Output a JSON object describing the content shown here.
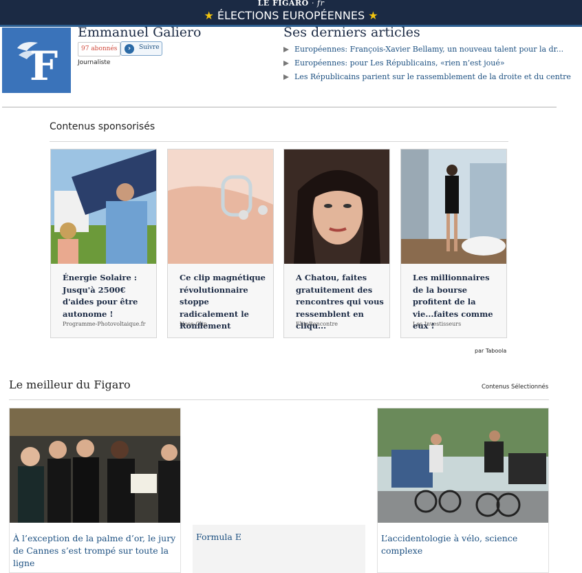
{
  "banner": {
    "brand": "LE FIGARO",
    "brand_suffix": "· fr",
    "title": "ÉLECTIONS EUROPÉENNES",
    "star": "★"
  },
  "author": {
    "logo_letter": "F",
    "name": "Emmanuel Galiero",
    "followers": "97 abonnés",
    "follow_label": "Suivre",
    "follow_icon": "›",
    "role": "Journaliste"
  },
  "latest": {
    "title": "Ses derniers articles",
    "items": [
      "Européennes: François-Xavier Bellamy, un nouveau talent pour la dr...",
      "Européennes: pour Les Républicains, «rien n’est joué»",
      "Les Républicains parient sur le rassemblement de la droite et du centre"
    ]
  },
  "sponsored": {
    "title": "Contenus sponsorisés",
    "credit": "par Taboola",
    "cards": [
      {
        "headline": "Énergie Solaire : Jusqu'à 2500€ d'aides pour être autonome !",
        "source": "Programme-Photovoltaique.fr"
      },
      {
        "headline": "Ce clip magnétique révolutionnaire stoppe radicalement le Ronflement",
        "source": "Nose-Clip"
      },
      {
        "headline": "A Chatou, faites gratuitement des rencontres qui vous ressemblent en cliqu...",
        "source": "EliteRencontre"
      },
      {
        "headline": "Les millionnaires de la bourse profitent de la vie...faites comme eux !",
        "source": "Les Investisseurs"
      }
    ]
  },
  "best": {
    "title": "Le meilleur du Figaro",
    "selected": "Contenus Sélectionnés",
    "cards": [
      {
        "caption": "À l’exception de la palme d’or, le jury de Cannes s’est trompé sur toute la ligne"
      },
      {
        "caption": "Formula E"
      },
      {
        "caption": "L’accidentologie à vélo, science complexe"
      }
    ]
  },
  "colors": {
    "navy": "#1b2a44",
    "link_blue": "#1b4f80",
    "logo_blue": "#3a73ba",
    "star_yellow": "#f2c40f",
    "follower_red": "#d0493b"
  }
}
